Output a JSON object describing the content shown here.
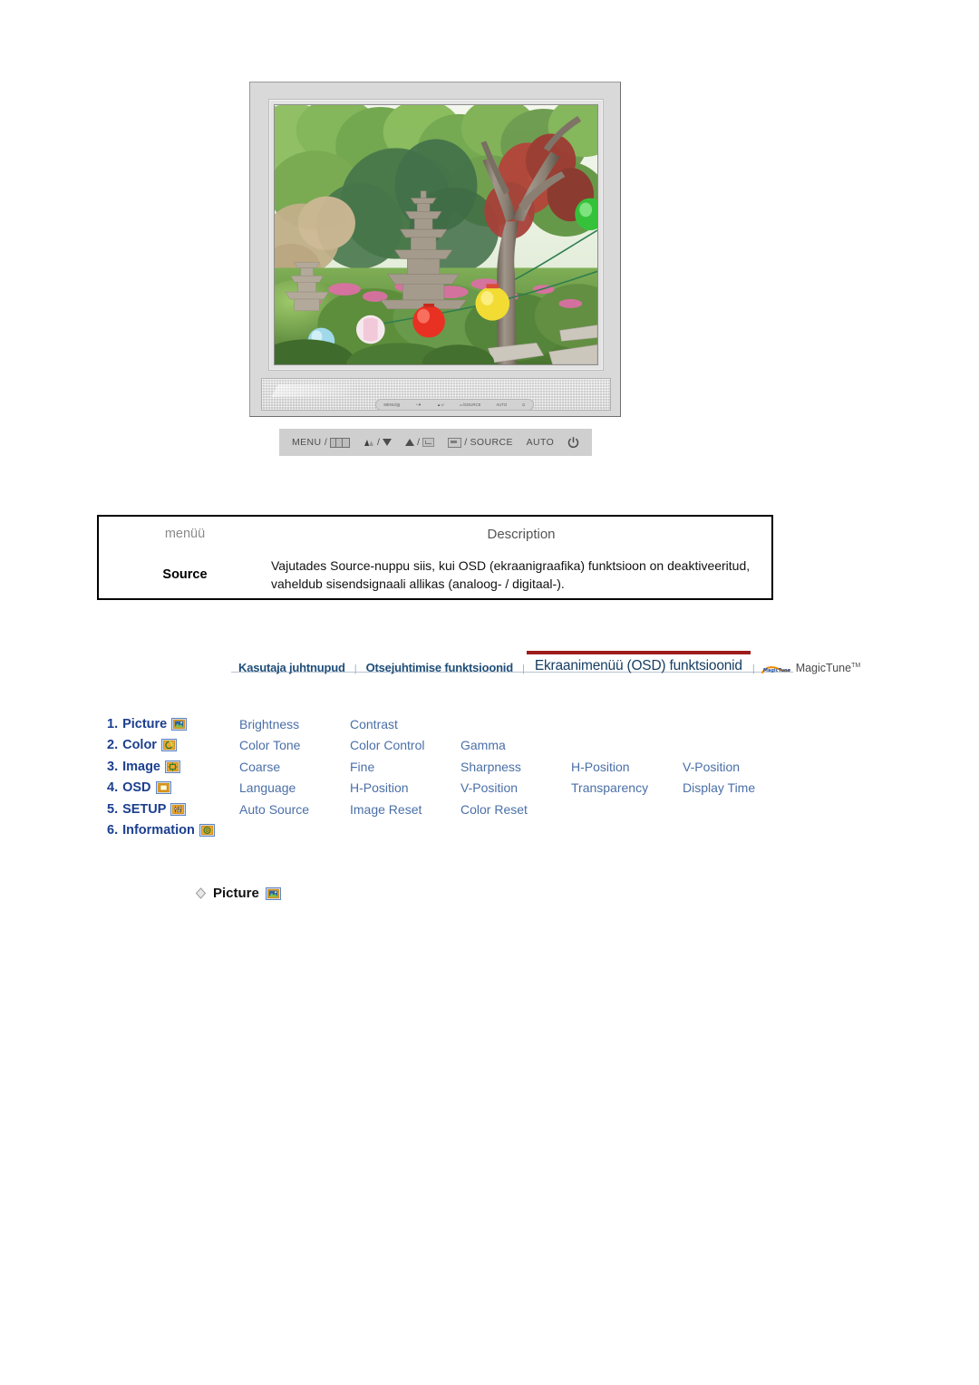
{
  "monitor": {
    "alt": "Samsung LCD monitor displaying a garden photo with a stone pagoda and paper lanterns",
    "mini_control_labels": [
      "MENU/",
      "/",
      "/",
      "/SOURCE",
      "AUTO",
      ""
    ]
  },
  "button_legend": {
    "menu_label": "MENU /",
    "menu_icon": "osd-bars-icon",
    "brightness_icon": "brightness-icon",
    "brightness_sep": "/",
    "down_icon": "triangle-down-icon",
    "up_icon": "triangle-up-icon",
    "up_sep": "/",
    "enter_icon": "enter-icon",
    "source_icon": "source-icon",
    "source_sep": "/",
    "source_label": "SOURCE",
    "auto_label": "AUTO",
    "power_icon": "power-icon"
  },
  "table": {
    "headers": [
      "menüü",
      "Description"
    ],
    "rows": [
      {
        "menu": "Source",
        "description": "Vajutades Source-nuppu siis, kui OSD (ekraanigraafika) funktsioon on deaktiveeritud, vaheldub sisendsignaali allikas (analoog- / digitaal-)."
      }
    ]
  },
  "navbar": {
    "items": [
      {
        "label": "Kasutaja juhtnupud",
        "active": false
      },
      {
        "label": "Otsejuhtimise funktsioonid",
        "active": false
      },
      {
        "label": "Ekraanimenüü (OSD) funktsioonid",
        "active": true
      }
    ],
    "separator": "|",
    "magictune_logo_alt": "MagicTune",
    "magictune_label": "MagicTune",
    "magictune_tm": "TM",
    "active_accent": "#9e1b1b",
    "link_color": "#1f4e79"
  },
  "menu_grid": {
    "rows": [
      {
        "number": "1.",
        "name": "Picture",
        "icon": "picture-icon",
        "items": [
          "Brightness",
          "Contrast"
        ]
      },
      {
        "number": "2.",
        "name": "Color",
        "icon": "color-icon",
        "items": [
          "Color Tone",
          "Color Control",
          "Gamma"
        ]
      },
      {
        "number": "3.",
        "name": "Image",
        "icon": "image-icon",
        "items": [
          "Coarse",
          "Fine",
          "Sharpness",
          "H-Position",
          "V-Position"
        ]
      },
      {
        "number": "4.",
        "name": "OSD",
        "icon": "osd-icon",
        "items": [
          "Language",
          "H-Position",
          "V-Position",
          "Transparency",
          "Display Time"
        ]
      },
      {
        "number": "5.",
        "name": "SETUP",
        "icon": "setup-icon",
        "items": [
          "Auto Source",
          "Image Reset",
          "Color Reset"
        ]
      },
      {
        "number": "6.",
        "name": "Information",
        "icon": "information-icon",
        "items": []
      }
    ],
    "label_color": "#1b3f8f",
    "item_color": "#4a6fa8"
  },
  "picture_section": {
    "bullet_icon": "diamond-bullet-icon",
    "title": "Picture",
    "icon": "picture-icon"
  }
}
